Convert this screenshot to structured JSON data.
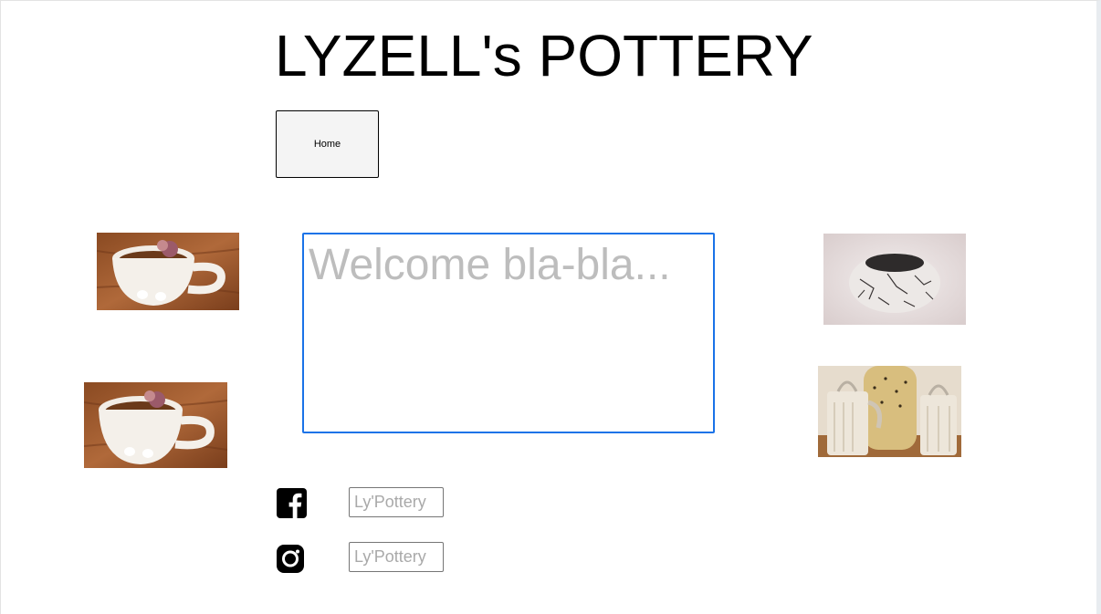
{
  "header": {
    "title": "LYZELL's POTTERY"
  },
  "nav": {
    "home_label": "Home"
  },
  "main": {
    "welcome_placeholder": "Welcome bla-bla...",
    "welcome_value": ""
  },
  "social": {
    "facebook": {
      "icon": "facebook-icon",
      "placeholder": "Ly'Pottery",
      "value": ""
    },
    "instagram": {
      "icon": "instagram-icon",
      "placeholder": "Ly'Pottery",
      "value": ""
    }
  },
  "colors": {
    "focus_border": "#1a73e8",
    "placeholder_text": "#bdbdbd"
  }
}
